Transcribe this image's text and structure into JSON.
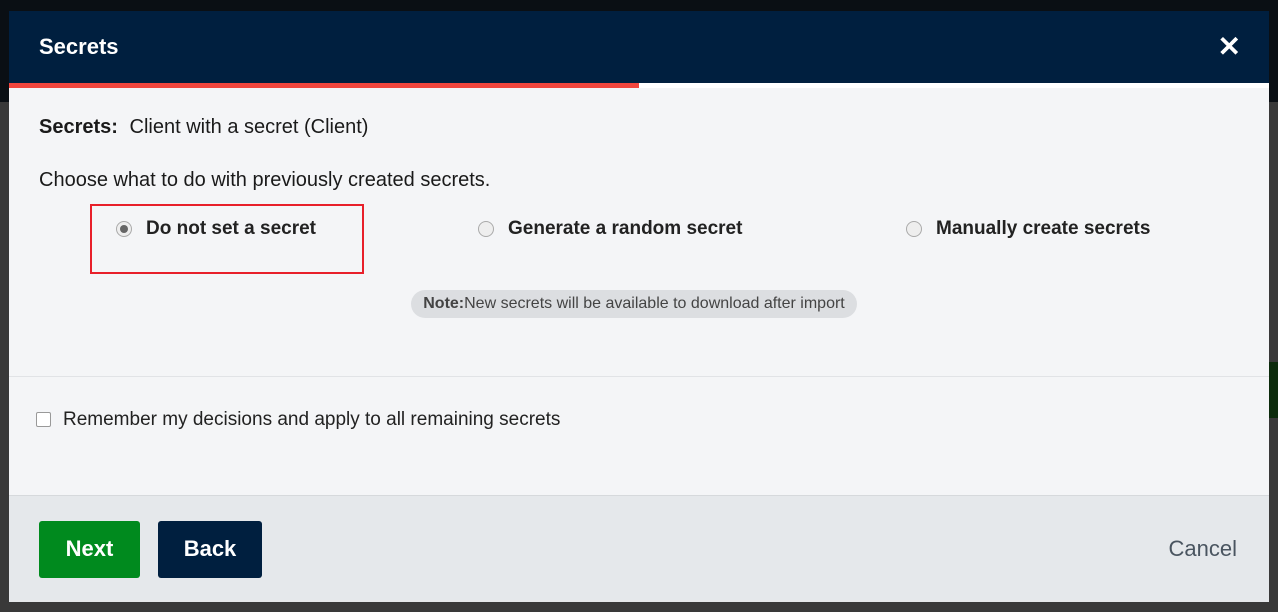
{
  "modal": {
    "title": "Secrets",
    "close_icon": "close-icon",
    "progress_percent": 50,
    "colors": {
      "header": "#001f3f",
      "progress": "#f1453d",
      "next": "#008a1e",
      "highlight": "#e8202a"
    }
  },
  "body": {
    "secrets_label": "Secrets:",
    "secrets_value": "Client with a secret (Client)",
    "prompt": "Choose what to do with previously created secrets.",
    "options": [
      {
        "label": "Do not set a secret",
        "selected": true
      },
      {
        "label": "Generate a random secret",
        "selected": false
      },
      {
        "label": "Manually create secrets",
        "selected": false
      }
    ],
    "note_label": "Note:",
    "note_text": "New secrets will be available to download after import"
  },
  "remember": {
    "label": "Remember my decisions and apply to all remaining secrets",
    "checked": false
  },
  "footer": {
    "next": "Next",
    "back": "Back",
    "cancel": "Cancel"
  }
}
